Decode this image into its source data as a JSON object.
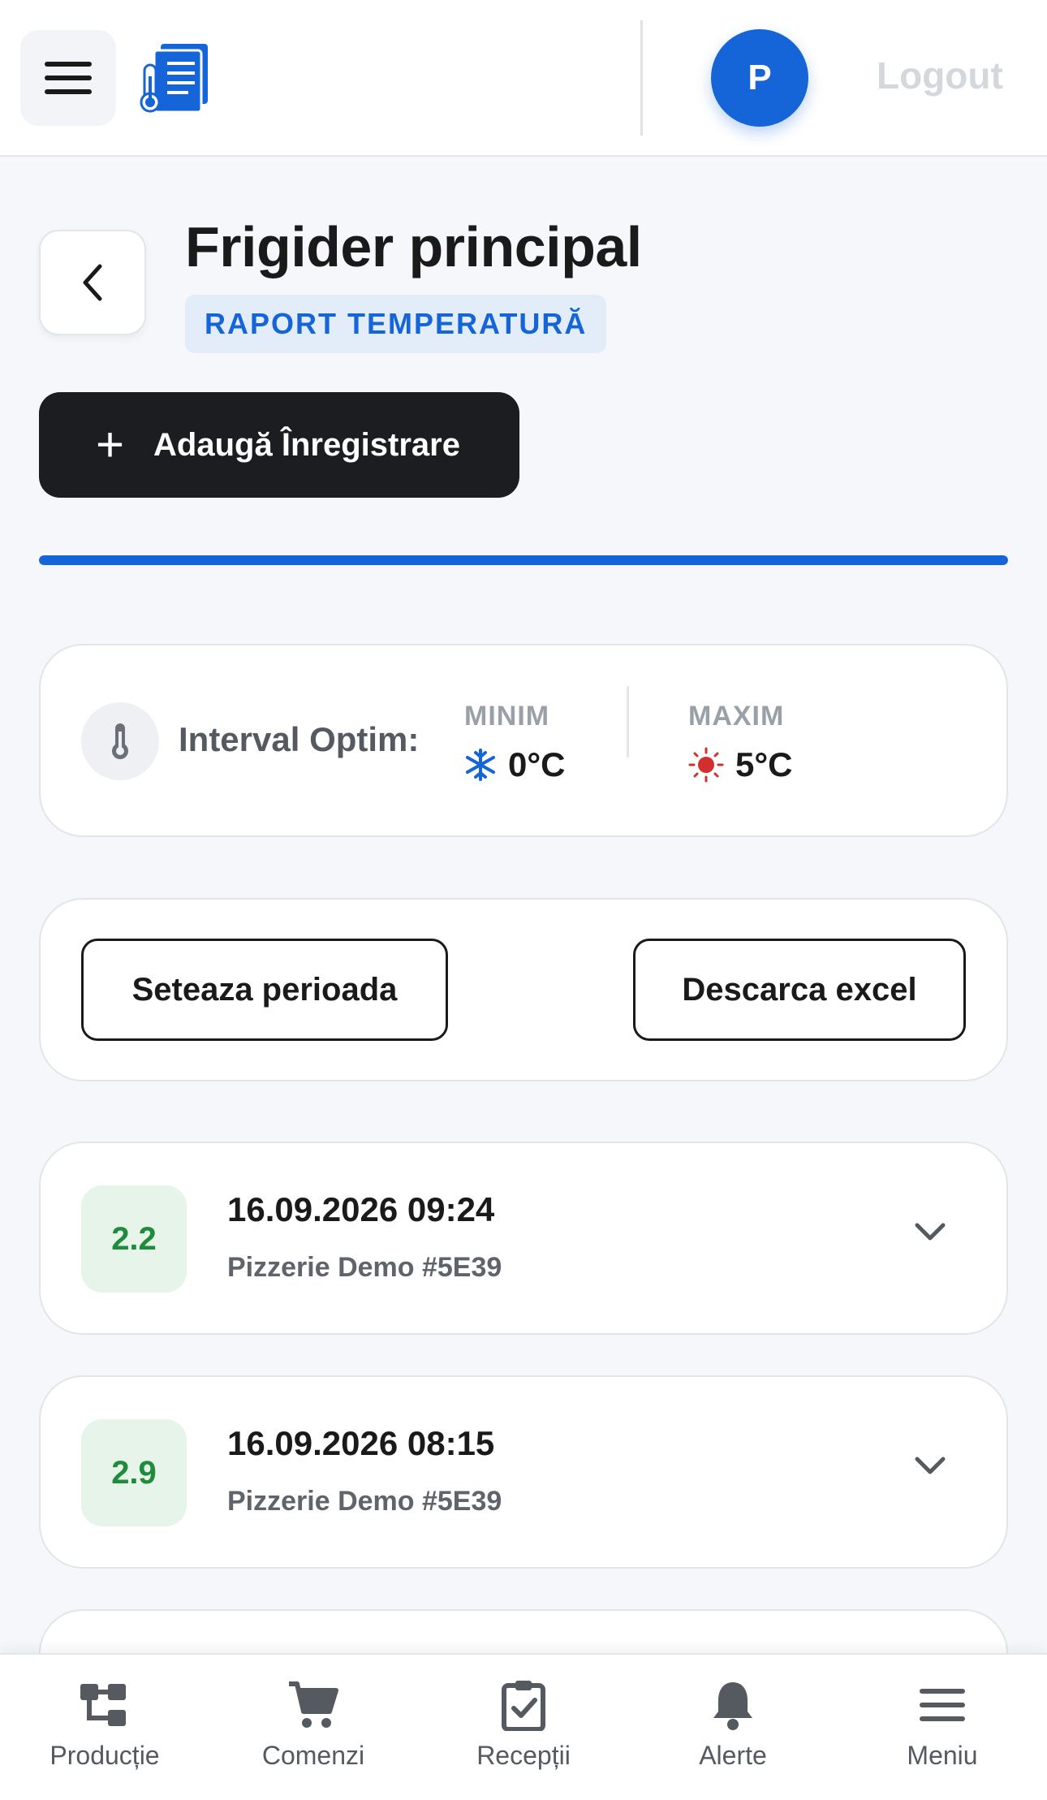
{
  "header": {
    "avatar_initial": "P",
    "logout_label": "Logout"
  },
  "page": {
    "title": "Frigider principal",
    "badge": "RAPORT TEMPERATURĂ",
    "add_button_label": "Adaugă Înregistrare",
    "progress_fraction": 1.0
  },
  "range": {
    "label": "Interval Optim:",
    "min_head": "MINIM",
    "min_value": "0°C",
    "max_head": "MAXIM",
    "max_value": "5°C"
  },
  "filters": {
    "period_button": "Seteaza perioada",
    "excel_button": "Descarca excel"
  },
  "records": [
    {
      "temp": "2.2",
      "datetime": "16.09.2026 09:24",
      "location": "Pizzerie Demo #5E39"
    },
    {
      "temp": "2.9",
      "datetime": "16.09.2026 08:15",
      "location": "Pizzerie Demo #5E39"
    }
  ],
  "nav": {
    "items": [
      {
        "label": "Producție",
        "icon": "production-icon"
      },
      {
        "label": "Comenzi",
        "icon": "cart-icon"
      },
      {
        "label": "Recepții",
        "icon": "clipboard-check-icon"
      },
      {
        "label": "Alerte",
        "icon": "bell-icon"
      },
      {
        "label": "Meniu",
        "icon": "menu-icon"
      }
    ]
  },
  "colors": {
    "accent": "#1565d8",
    "dark_button": "#1c1d20",
    "ok_green": "#1e8c3a",
    "ok_green_bg": "#e6f4ea",
    "cold_blue": "#1565d8",
    "hot_red": "#d32f2f"
  }
}
